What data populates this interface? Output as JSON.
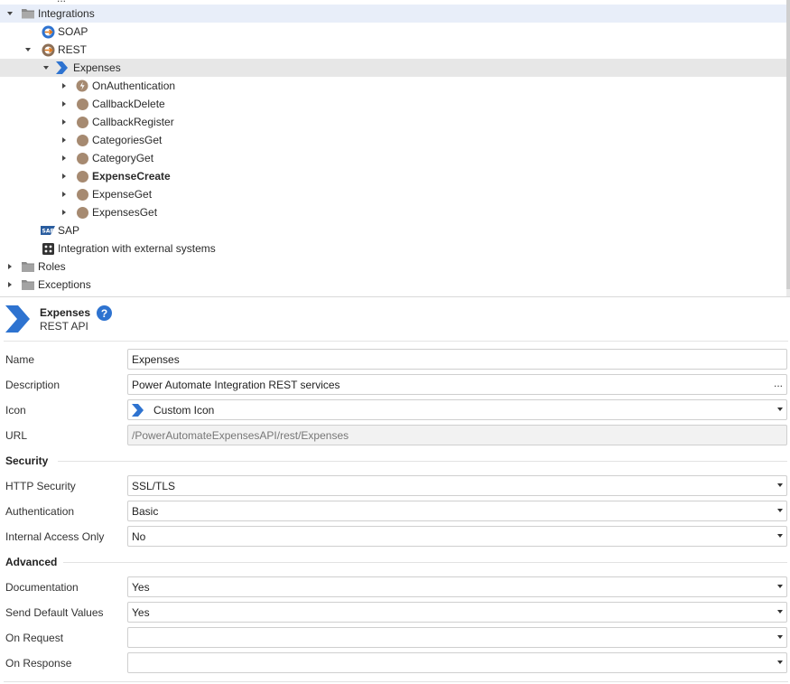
{
  "tree": {
    "cut_text": "...",
    "items": [
      {
        "label": "Integrations",
        "icon": "folder-open-icon"
      },
      {
        "label": "SOAP",
        "icon": "soap-icon"
      },
      {
        "label": "REST",
        "icon": "rest-icon"
      },
      {
        "label": "Expenses",
        "icon": "rest-api-chevron-icon"
      },
      {
        "label": "OnAuthentication",
        "icon": "on-authentication-icon"
      },
      {
        "label": "CallbackDelete",
        "icon": "method-icon"
      },
      {
        "label": "CallbackRegister",
        "icon": "method-icon"
      },
      {
        "label": "CategoriesGet",
        "icon": "method-icon"
      },
      {
        "label": "CategoryGet",
        "icon": "method-icon"
      },
      {
        "label": "ExpenseCreate",
        "icon": "method-icon"
      },
      {
        "label": "ExpenseGet",
        "icon": "method-icon"
      },
      {
        "label": "ExpensesGet",
        "icon": "method-icon"
      },
      {
        "label": "SAP",
        "icon": "sap-icon"
      },
      {
        "label": "Integration with external systems",
        "icon": "puzzle-icon"
      },
      {
        "label": "Roles",
        "icon": "folder-icon"
      },
      {
        "label": "Exceptions",
        "icon": "folder-icon"
      }
    ]
  },
  "properties": {
    "title": "Expenses",
    "subtitle": "REST API",
    "help": "?",
    "rows": {
      "name": {
        "label": "Name",
        "value": "Expenses"
      },
      "description": {
        "label": "Description",
        "value": "Power Automate Integration REST services",
        "extra": "..."
      },
      "icon": {
        "label": "Icon",
        "value": "Custom Icon"
      },
      "url": {
        "label": "URL",
        "value": "/PowerAutomateExpensesAPI/rest/Expenses"
      }
    },
    "security": {
      "heading": "Security",
      "http_security": {
        "label": "HTTP Security",
        "value": "SSL/TLS"
      },
      "authentication": {
        "label": "Authentication",
        "value": "Basic"
      },
      "internal_access_only": {
        "label": "Internal Access Only",
        "value": "No"
      }
    },
    "advanced": {
      "heading": "Advanced",
      "documentation": {
        "label": "Documentation",
        "value": "Yes"
      },
      "send_default_values": {
        "label": "Send Default Values",
        "value": "Yes"
      },
      "on_request": {
        "label": "On Request",
        "value": ""
      },
      "on_response": {
        "label": "On Response",
        "value": ""
      }
    }
  },
  "colors": {
    "selection_blue": "#e8eef9",
    "selection_gray": "#e7e7e7",
    "accent": "#2e73d0",
    "method_brown": "#a68a71"
  }
}
